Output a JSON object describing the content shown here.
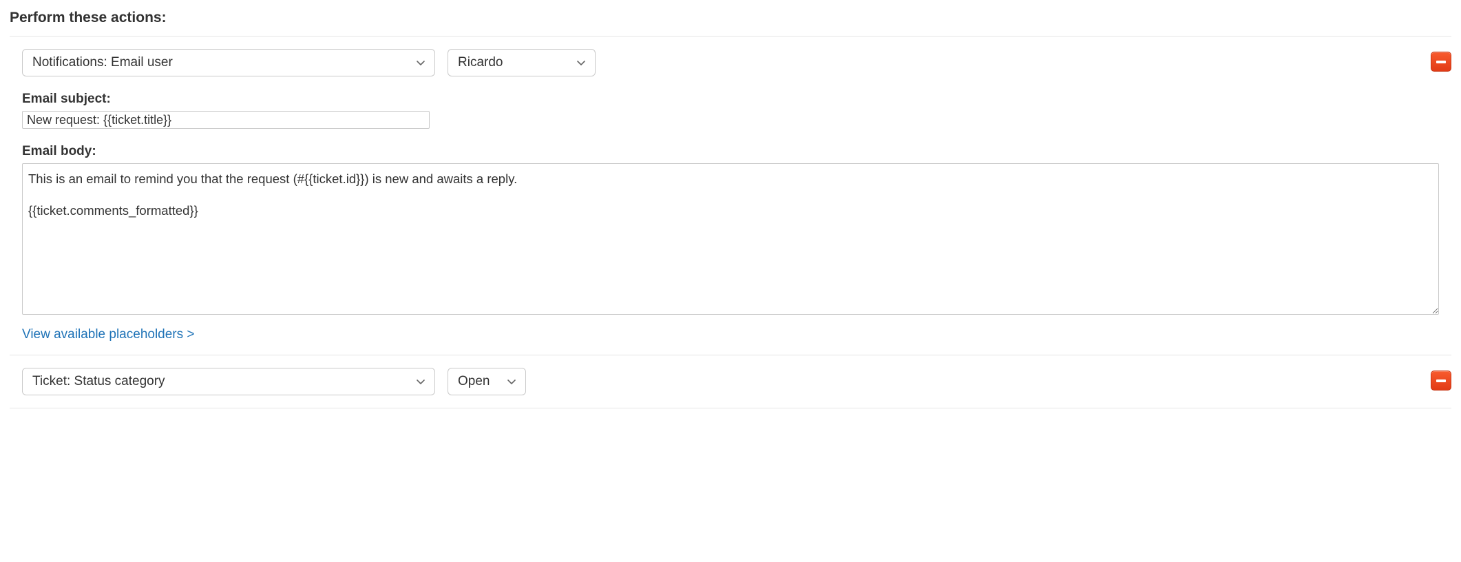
{
  "section_title": "Perform these actions:",
  "action1": {
    "type_select": "Notifications: Email user",
    "user_select": "Ricardo",
    "subject_label": "Email subject:",
    "subject_value": "New request: {{ticket.title}}",
    "body_label": "Email body:",
    "body_value": "This is an email to remind you that the request (#{{ticket.id}}) is new and awaits a reply.\n\n{{ticket.comments_formatted}}",
    "placeholders_link": "View available placeholders >"
  },
  "action2": {
    "type_select": "Ticket: Status category",
    "value_select": "Open"
  }
}
